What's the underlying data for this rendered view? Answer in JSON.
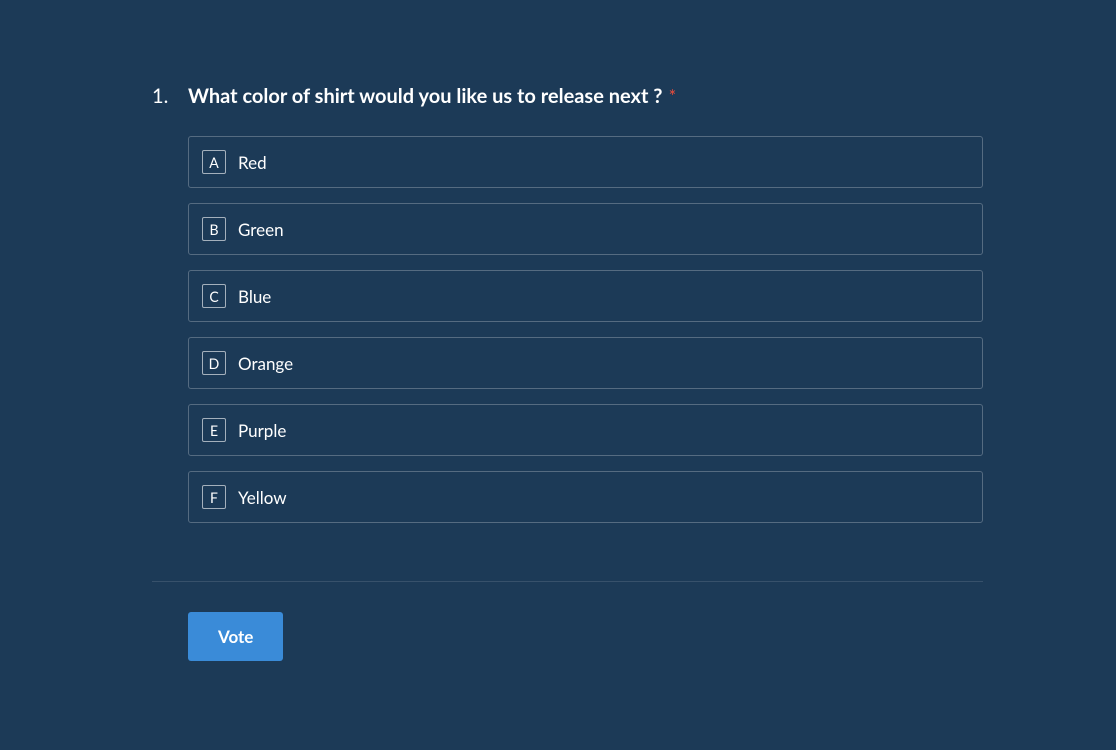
{
  "question": {
    "number": "1.",
    "text": "What color of shirt would you like us to release next ?",
    "required": true,
    "required_mark": "*"
  },
  "options": [
    {
      "letter": "A",
      "label": "Red"
    },
    {
      "letter": "B",
      "label": "Green"
    },
    {
      "letter": "C",
      "label": "Blue"
    },
    {
      "letter": "D",
      "label": "Orange"
    },
    {
      "letter": "E",
      "label": "Purple"
    },
    {
      "letter": "F",
      "label": "Yellow"
    }
  ],
  "button": {
    "vote_label": "Vote"
  }
}
